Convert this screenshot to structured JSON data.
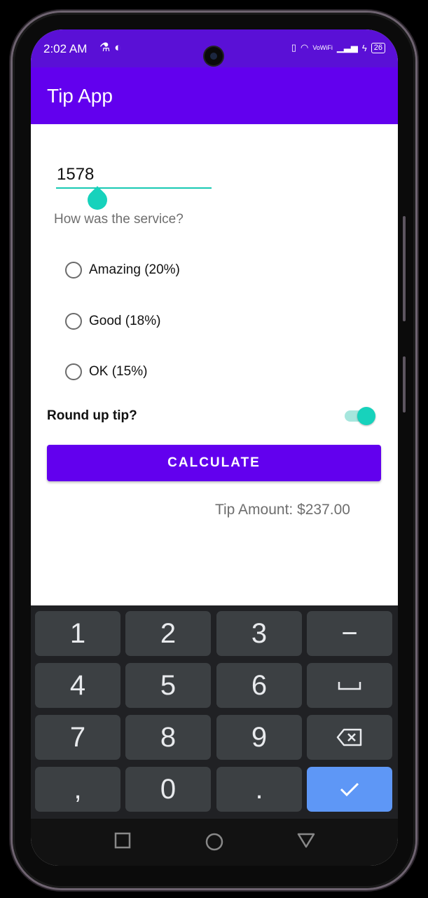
{
  "status": {
    "time": "2:02 AM",
    "left_icons": [
      "flask-icon",
      "tracking-icon"
    ],
    "signal_text": "VoWiFi",
    "battery": "26"
  },
  "app": {
    "title": "Tip App"
  },
  "form": {
    "cost_value": "1578",
    "question": "How was the service?",
    "options": [
      "Amazing (20%)",
      "Good (18%)",
      "OK (15%)"
    ],
    "selected_option": null,
    "roundup_label": "Round up tip?",
    "roundup_on": true,
    "calculate_label": "CALCULATE",
    "tip_result": "Tip Amount: $237.00"
  },
  "keyboard": {
    "row1": [
      "1",
      "2",
      "3",
      "−"
    ],
    "row2": [
      "4",
      "5",
      "6",
      "space-icon"
    ],
    "row3": [
      "7",
      "8",
      "9",
      "backspace-icon"
    ],
    "row4": [
      ",",
      "0",
      ".",
      "check-icon"
    ]
  },
  "nav": [
    "recents-icon",
    "home-icon",
    "back-icon"
  ],
  "colors": {
    "primary": "#6200ee",
    "status_bar": "#5a10d6",
    "accent": "#17d2bc",
    "keyboard_bg": "#202124",
    "key_bg": "#3c4043",
    "enter_key": "#5e97f6"
  }
}
